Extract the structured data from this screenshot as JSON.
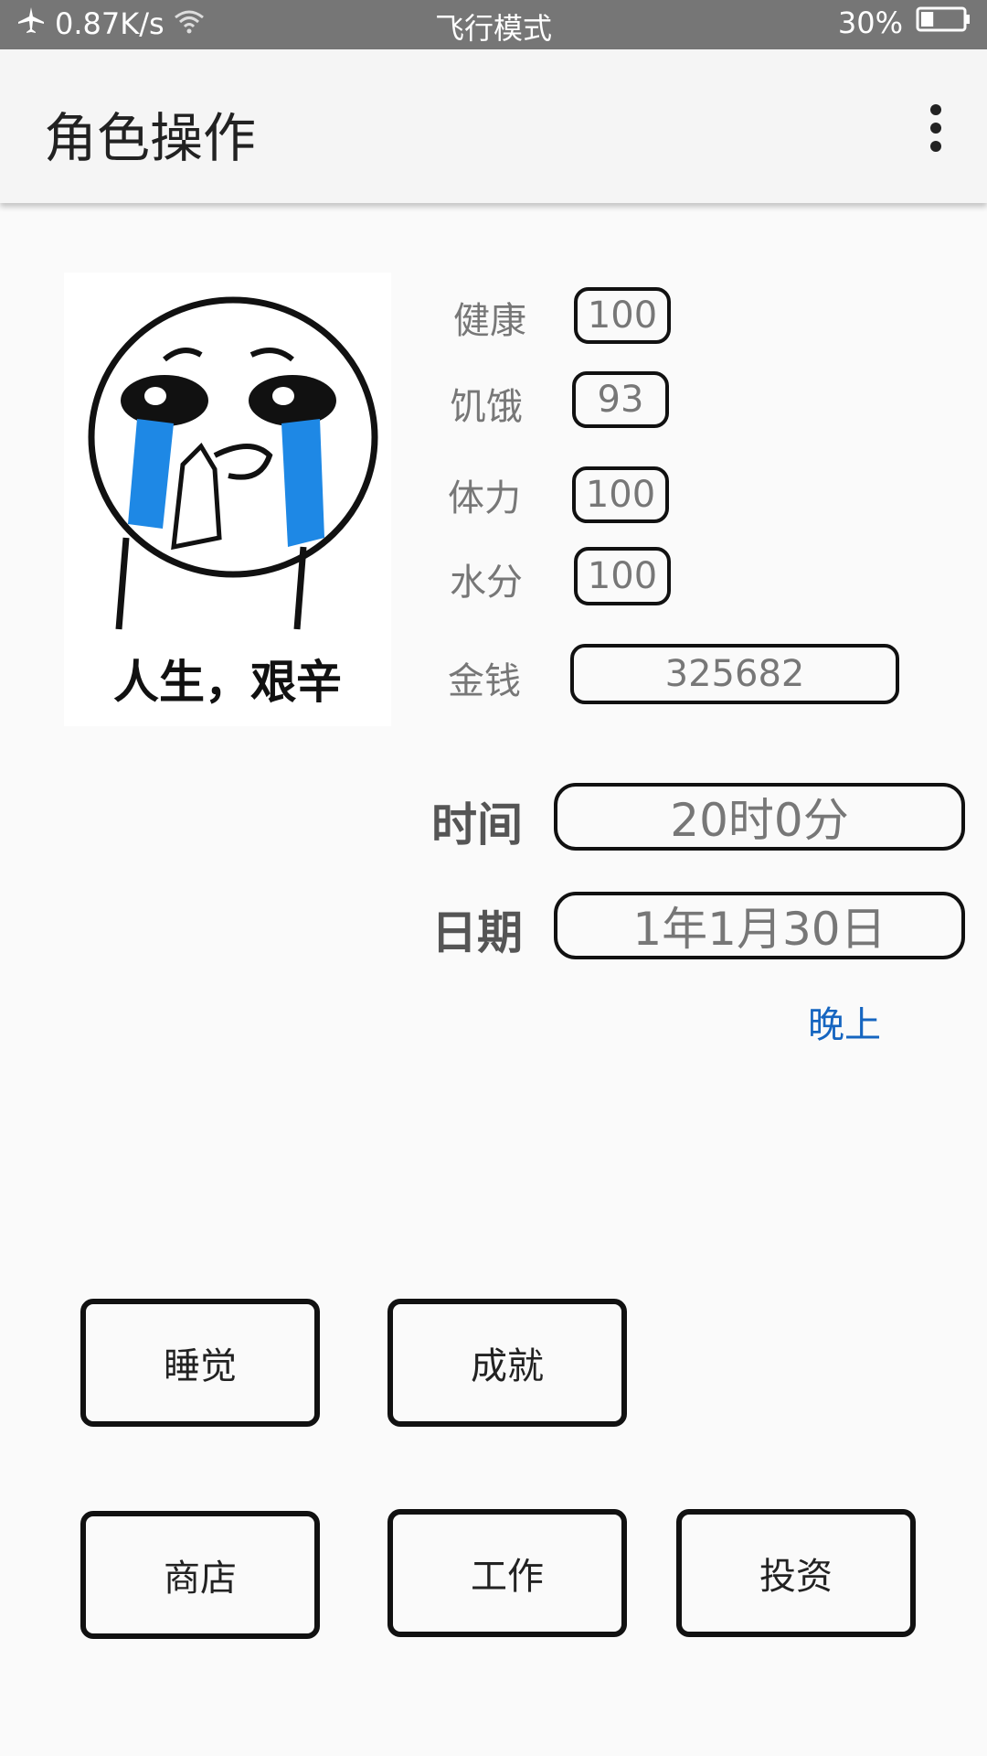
{
  "status_bar": {
    "speed": "0.87K/s",
    "mode": "飞行模式",
    "battery": "30%",
    "battery_level": 0.3,
    "icons": [
      "airplane-icon",
      "wifi-icon",
      "battery-icon"
    ]
  },
  "app_bar": {
    "title": "角色操作",
    "menu_icon": "more-vert-icon"
  },
  "avatar": {
    "caption": "人生，艰辛"
  },
  "stats": [
    {
      "label": "健康",
      "value": "100"
    },
    {
      "label": "饥饿",
      "value": "93"
    },
    {
      "label": "体力",
      "value": "100"
    },
    {
      "label": "水分",
      "value": "100"
    }
  ],
  "money": {
    "label": "金钱",
    "value": "325682"
  },
  "time": {
    "label": "时间",
    "value": "20时0分"
  },
  "date": {
    "label": "日期",
    "value": "1年1月30日"
  },
  "period": "晚上",
  "actions": {
    "sleep": "睡觉",
    "achievement": "成就",
    "shop": "商店",
    "work": "工作",
    "invest": "投资"
  },
  "colors": {
    "status_bar": "#767676",
    "app_bar": "#f5f5f5",
    "background": "#fafafa",
    "accent_blue": "#1565c0",
    "tear_blue": "#1e88e5"
  }
}
